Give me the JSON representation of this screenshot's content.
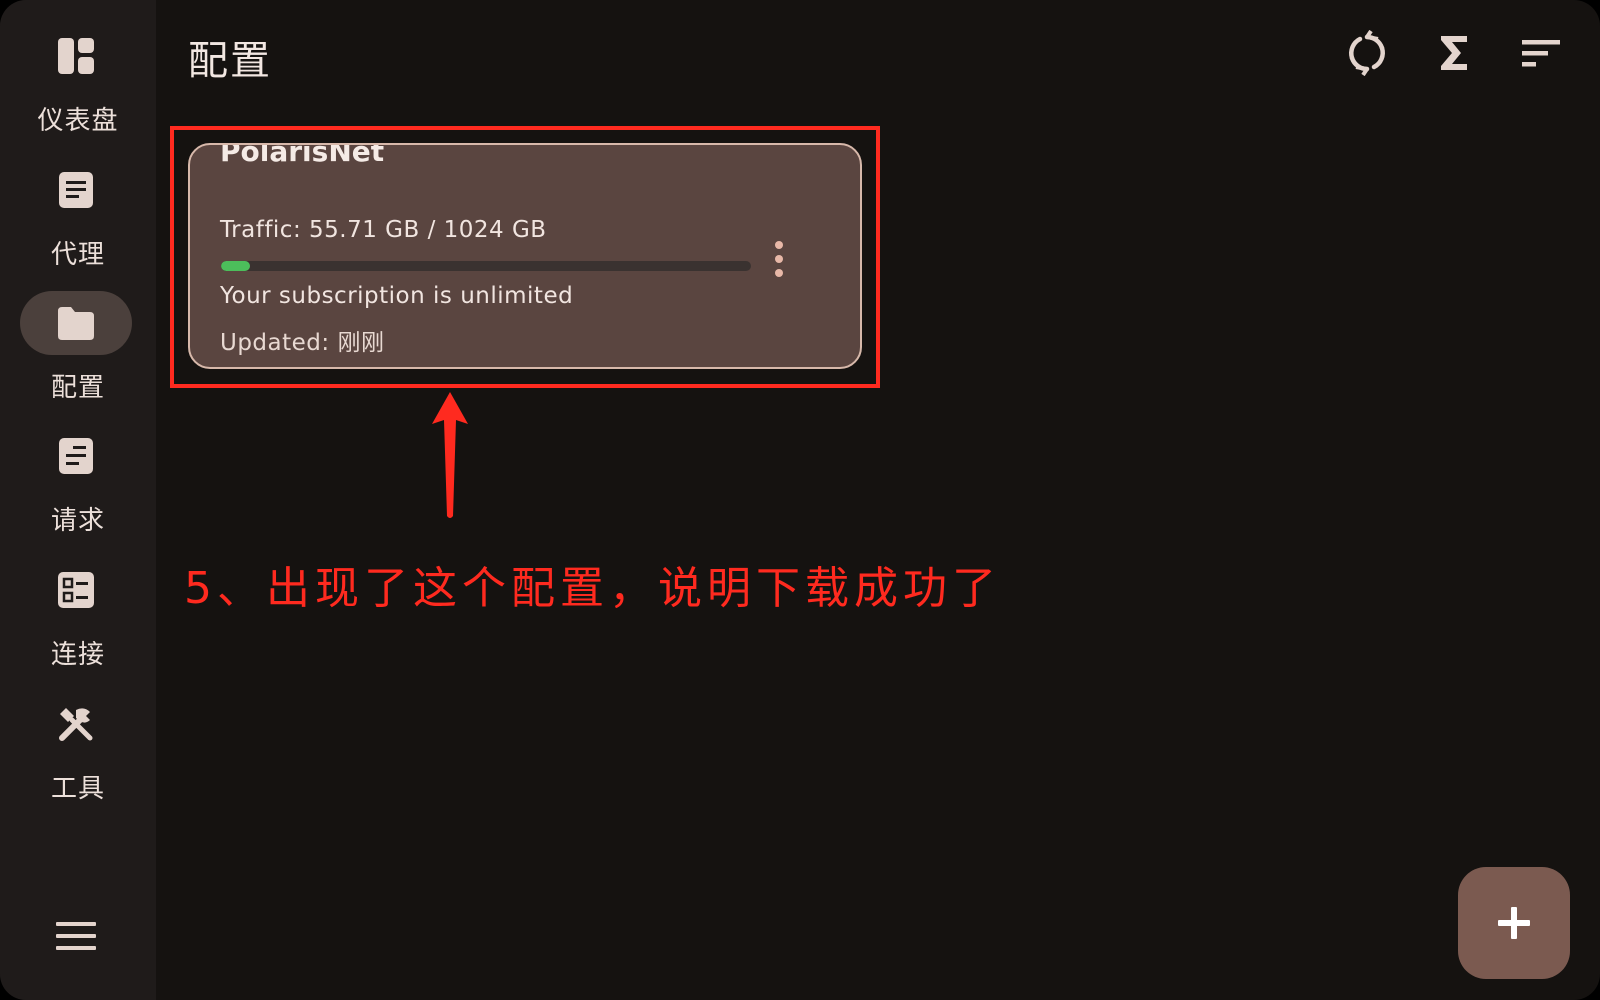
{
  "app": {
    "page_title": "配置"
  },
  "sidebar": {
    "items": [
      {
        "label": "仪表盘",
        "icon": "dashboard-icon",
        "active": false
      },
      {
        "label": "代理",
        "icon": "document-icon",
        "active": false
      },
      {
        "label": "配置",
        "icon": "folder-icon",
        "active": true
      },
      {
        "label": "请求",
        "icon": "requests-icon",
        "active": false
      },
      {
        "label": "连接",
        "icon": "connections-icon",
        "active": false
      },
      {
        "label": "工具",
        "icon": "tools-icon",
        "active": false
      }
    ],
    "menu_icon": "menu-icon"
  },
  "header": {
    "actions": [
      "sync-icon",
      "sigma-icon",
      "sort-icon"
    ]
  },
  "profile_card": {
    "name": "PolarisNet",
    "traffic_text": "Traffic: 55.71 GB / 1024 GB",
    "traffic_used_fraction": 0.054,
    "subscription_text": "Your subscription is unlimited",
    "updated_text": "Updated: 刚刚",
    "more_icon": "more-vertical-icon"
  },
  "annotation": {
    "text": "5、出现了这个配置，说明下载成功了",
    "color": "#ff2a1f"
  },
  "fab": {
    "icon": "plus-icon"
  },
  "colors": {
    "background": "#151210",
    "sidebar": "#1f1b1a",
    "card": "#5a4540",
    "card_border": "#d7b8aa",
    "progress": "#4cbe5b",
    "fab": "#7b5a50",
    "active_pill": "#4b403c"
  }
}
